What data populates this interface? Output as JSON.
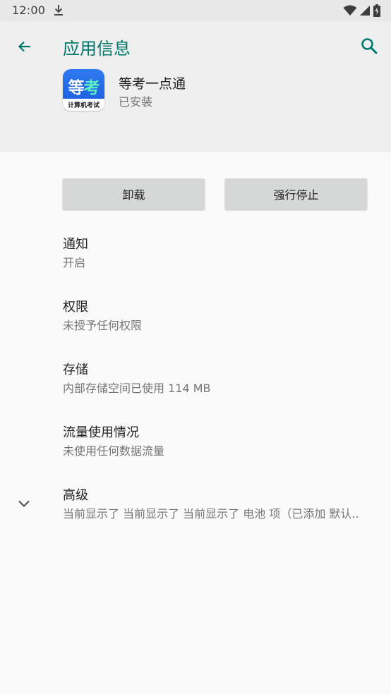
{
  "status_bar": {
    "time": "12:00"
  },
  "header": {
    "title": "应用信息"
  },
  "app": {
    "name": "等考一点通",
    "status": "已安装",
    "icon_text_left": "等",
    "icon_text_right": "考",
    "icon_caption": "计算机考试"
  },
  "buttons": {
    "uninstall": "卸载",
    "force_stop": "强行停止"
  },
  "settings": [
    {
      "title": "通知",
      "summary": "开启"
    },
    {
      "title": "权限",
      "summary": "未授予任何权限"
    },
    {
      "title": "存储",
      "summary": "内部存储空间已使用 114 MB"
    },
    {
      "title": "流量使用情况",
      "summary": "未使用任何数据流量"
    },
    {
      "title": "高级",
      "summary": "当前显示了 当前显示了 当前显示了 电池 项（已添加 默认.."
    }
  ],
  "colors": {
    "accent": "#00796b",
    "header_bg": "#efefef",
    "icon_blue": "#2f7bf2"
  },
  "icons": [
    "download-icon",
    "wifi-icon",
    "signal-icon",
    "battery-icon",
    "back-arrow-icon",
    "search-icon",
    "chevron-down-icon"
  ]
}
